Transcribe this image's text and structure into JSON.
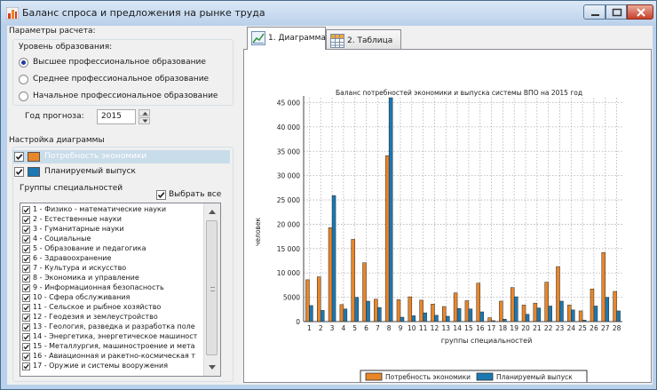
{
  "window": {
    "title": "Баланс спроса и предложения на рынке труда"
  },
  "params": {
    "title": "Параметры расчета:",
    "edu_label": "Уровень образования:",
    "edu_options": [
      {
        "label": "Высшее профессиональное образование",
        "selected": true
      },
      {
        "label": "Среднее профессиональное образование",
        "selected": false
      },
      {
        "label": "Начальное профессиональное образование",
        "selected": false
      }
    ],
    "year_label": "Год прогноза:",
    "year_value": "2015"
  },
  "settings": {
    "title": "Настройка диаграммы",
    "series_toggles": [
      {
        "label": "Потребность экономики",
        "checked": true,
        "color": "#e8862a",
        "highlighted": true
      },
      {
        "label": "Планируемый выпуск",
        "checked": true,
        "color": "#1b78b3",
        "highlighted": false
      }
    ],
    "groups_label": "Группы специальностей",
    "select_all_label": "Выбрать все",
    "select_all_checked": true
  },
  "groups": [
    "1 - Физико - математические науки",
    "2 - Естественные науки",
    "3 - Гуманитарные науки",
    "4 - Социальные",
    "5 - Образование и педагогика",
    "6 - Здравоохранение",
    "7 - Культура и искусство",
    "8 - Экономика и управление",
    "9 - Информационная безопасность",
    "10 - Сфера обслуживания",
    "11 - Сельское и рыбное хозяйство",
    "12 - Геодезия и землеустройство",
    "13 - Геология, разведка и разработка поле",
    "14 - Энергетика, энергетическое машиност",
    "15 - Металлургия, машиностроение и мета",
    "16 - Авиационная и ракетно-космическая т",
    "17 - Оружие и системы вооружения"
  ],
  "tabs": [
    {
      "label": "1. Диаграмма",
      "active": true,
      "icon": "chart-icon"
    },
    {
      "label": "2. Таблица",
      "active": false,
      "icon": "table-icon"
    }
  ],
  "colors": {
    "demand": "#e8862a",
    "supply": "#1b78b3"
  },
  "chart_data": {
    "type": "bar",
    "title": "Баланс потребностей экономики и выпуска системы ВПО на 2015 год",
    "xlabel": "группы специальностей",
    "ylabel": "человек",
    "ylim": [
      0,
      46000
    ],
    "yticks": [
      0,
      5000,
      10000,
      15000,
      20000,
      25000,
      30000,
      35000,
      40000,
      45000
    ],
    "ytick_labels": [
      "0",
      "5000",
      "10 000",
      "15 000",
      "20 000",
      "25 000",
      "30 000",
      "35 000",
      "40 000",
      "45 000"
    ],
    "grid": true,
    "legend_position": "bottom",
    "categories": [
      "1",
      "2",
      "3",
      "4",
      "5",
      "6",
      "7",
      "8",
      "9",
      "10",
      "11",
      "12",
      "13",
      "14",
      "15",
      "16",
      "17",
      "18",
      "19",
      "20",
      "21",
      "22",
      "23",
      "24",
      "25",
      "26",
      "27",
      "28"
    ],
    "series": [
      {
        "name": "Потребность экономики",
        "values": [
          8600,
          9200,
          19300,
          3500,
          16900,
          12100,
          4600,
          34100,
          4500,
          5100,
          4400,
          3600,
          3100,
          5900,
          4300,
          7900,
          800,
          4200,
          7000,
          3400,
          3800,
          8100,
          11300,
          3400,
          2200,
          6700,
          14200,
          6200
        ]
      },
      {
        "name": "Планируемый выпуск",
        "values": [
          3300,
          2300,
          25900,
          2600,
          5000,
          4200,
          2900,
          46000,
          900,
          1200,
          1800,
          1300,
          1100,
          2700,
          2600,
          2000,
          200,
          500,
          5100,
          1500,
          2800,
          3200,
          4200,
          2400,
          300,
          3200,
          5000,
          2200
        ]
      }
    ]
  }
}
